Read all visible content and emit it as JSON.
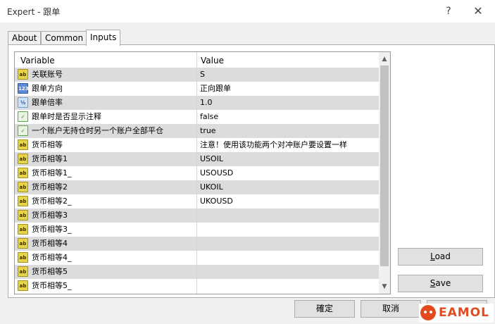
{
  "window": {
    "title": "Expert - 跟单",
    "help_glyph": "?",
    "close_glyph": "✕"
  },
  "tabs": [
    {
      "label": "About",
      "active": false
    },
    {
      "label": "Common",
      "active": false
    },
    {
      "label": "Inputs",
      "active": true
    }
  ],
  "grid": {
    "headers": {
      "variable": "Variable",
      "value": "Value"
    },
    "rows": [
      {
        "icon": "ab",
        "icon_name": "string-type-icon",
        "name": "关联账号",
        "value": "S"
      },
      {
        "icon": "123",
        "icon_name": "integer-type-icon",
        "name": "跟单方向",
        "value": "正向跟单"
      },
      {
        "icon": "½",
        "icon_name": "double-type-icon",
        "name": "跟单倍率",
        "value": "1.0"
      },
      {
        "icon": "✓",
        "icon_name": "bool-type-icon",
        "name": "跟单时是否显示注释",
        "value": "false"
      },
      {
        "icon": "✓",
        "icon_name": "bool-type-icon",
        "name": "一个账户无持仓时另一个账户全部平仓",
        "value": "true"
      },
      {
        "icon": "ab",
        "icon_name": "string-type-icon",
        "name": "货币相等",
        "value": "注意！使用该功能两个对冲账户要设置一样"
      },
      {
        "icon": "ab",
        "icon_name": "string-type-icon",
        "name": "货币相等1",
        "value": "USOIL"
      },
      {
        "icon": "ab",
        "icon_name": "string-type-icon",
        "name": "货币相等1_",
        "value": "USOUSD"
      },
      {
        "icon": "ab",
        "icon_name": "string-type-icon",
        "name": "货币相等2",
        "value": "UKOIL"
      },
      {
        "icon": "ab",
        "icon_name": "string-type-icon",
        "name": "货币相等2_",
        "value": "UKOUSD"
      },
      {
        "icon": "ab",
        "icon_name": "string-type-icon",
        "name": "货币相等3",
        "value": ""
      },
      {
        "icon": "ab",
        "icon_name": "string-type-icon",
        "name": "货币相等3_",
        "value": ""
      },
      {
        "icon": "ab",
        "icon_name": "string-type-icon",
        "name": "货币相等4",
        "value": ""
      },
      {
        "icon": "ab",
        "icon_name": "string-type-icon",
        "name": "货币相等4_",
        "value": ""
      },
      {
        "icon": "ab",
        "icon_name": "string-type-icon",
        "name": "货币相等5",
        "value": ""
      },
      {
        "icon": "ab",
        "icon_name": "string-type-icon",
        "name": "货币相等5_",
        "value": ""
      }
    ]
  },
  "scrollbar": {
    "up_glyph": "▲",
    "down_glyph": "▼"
  },
  "buttons": {
    "load": {
      "accel": "L",
      "rest": "oad"
    },
    "save": {
      "accel": "S",
      "rest": "ave"
    },
    "ok": "確定",
    "cancel": "取消",
    "reset": ""
  },
  "watermark": {
    "text": "EAMOL"
  },
  "colors": {
    "row_alt": "#dcdcdc",
    "watermark": "#e34b1f"
  }
}
